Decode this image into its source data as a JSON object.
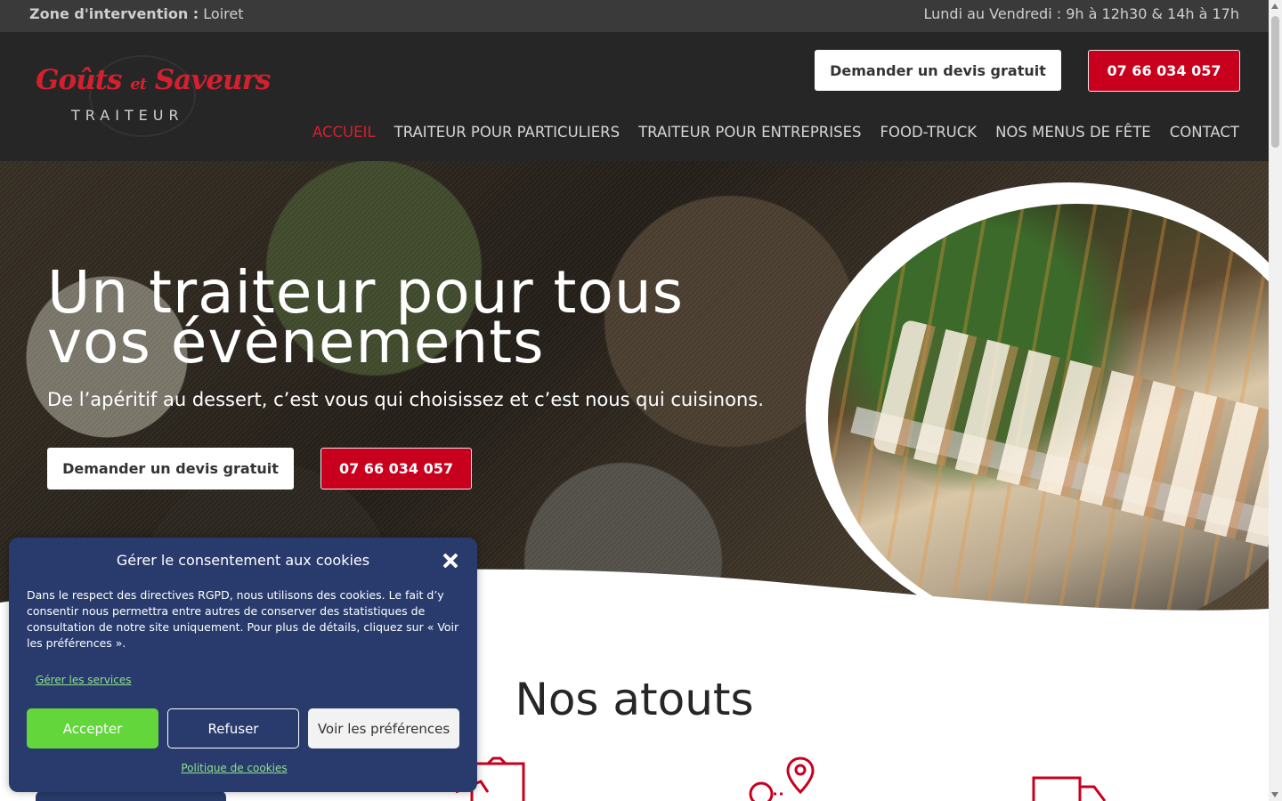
{
  "topbar": {
    "zone_label": "Zone d'intervention :",
    "zone_value": "Loiret",
    "hours": "Lundi au Vendredi : 9h à 12h30 & 14h à 17h"
  },
  "header": {
    "logo_script": "Goûts et Saveurs",
    "logo_script_main1": "Goûts",
    "logo_script_small": "et",
    "logo_script_main2": "Saveurs",
    "logo_sub": "TRAITEUR",
    "quote_button": "Demander un devis gratuit",
    "phone_button": "07 66 034 057"
  },
  "nav": {
    "items": [
      {
        "label": "ACCUEIL",
        "active": true
      },
      {
        "label": "TRAITEUR POUR PARTICULIERS"
      },
      {
        "label": "TRAITEUR POUR ENTREPRISES"
      },
      {
        "label": "FOOD-TRUCK"
      },
      {
        "label": "NOS MENUS DE FÊTE"
      },
      {
        "label": "CONTACT"
      }
    ]
  },
  "hero": {
    "title_line1": "Un traiteur pour tous",
    "title_line2": "vos évènements",
    "lead": "De l’apéritif au dessert, c’est vous qui choisissez et c’est nous qui cuisinons.",
    "quote_button": "Demander un devis gratuit",
    "phone_button": "07 66 034 057"
  },
  "section": {
    "title": "Nos atouts",
    "icons": [
      "food-box-icon",
      "map-pin-route-icon",
      "delivery-truck-icon"
    ]
  },
  "cookie": {
    "title": "Gérer le consentement aux cookies",
    "text": "Dans le respect des directives RGPD, nous utilisons des cookies. Le fait d’y consentir nous permettra entre autres de conserver des statistiques de consultation de notre site uniquement. Pour plus de détails, cliquez sur « Voir les préférences ».",
    "manage_link": "Gérer les services",
    "accept": "Accepter",
    "refuse": "Refuser",
    "preferences": "Voir les préférences",
    "policy_link": "Politique de cookies"
  },
  "colors": {
    "brand_red": "#c8001e",
    "header_bg": "#262626",
    "cookie_bg": "#293b6d",
    "accept_green": "#62d63b"
  }
}
